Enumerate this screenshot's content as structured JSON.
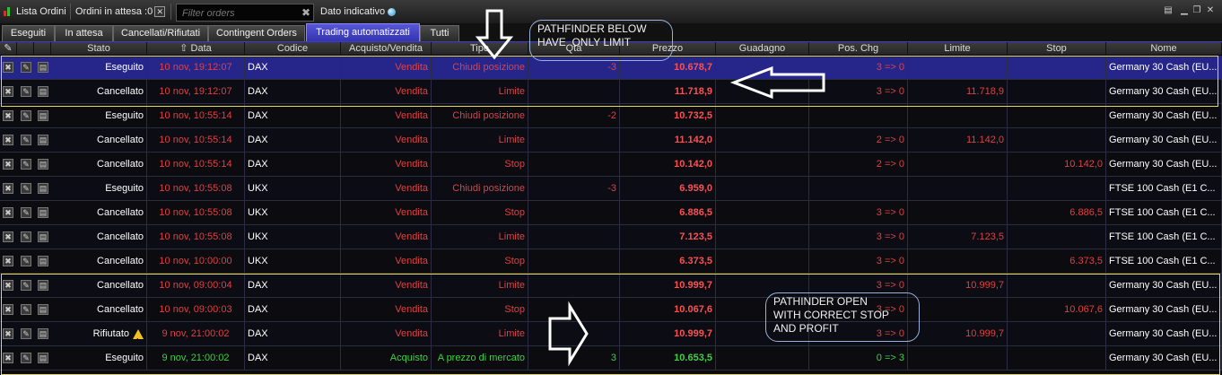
{
  "toolbar": {
    "title": "Lista Ordini",
    "pending_label": "Ordini in attesa :0",
    "filter_placeholder": "Filter orders",
    "indicative_label": "Dato indicativo"
  },
  "tabs": [
    {
      "label": "Eseguiti",
      "active": false
    },
    {
      "label": "In attesa",
      "active": false
    },
    {
      "label": "Cancellati/Rifiutati",
      "active": false
    },
    {
      "label": "Contingent Orders",
      "active": false
    },
    {
      "label": "Trading automatizzati",
      "active": true
    },
    {
      "label": "Tutti",
      "active": false
    }
  ],
  "columns": [
    "Stato",
    "Data",
    "Codice",
    "Acquisto/Vendita",
    "Tipo",
    "Qtà",
    "Prezzo",
    "Guadagno",
    "Pos. Chg",
    "Limite",
    "Stop",
    "Nome"
  ],
  "rows": [
    {
      "stato": "Eseguito",
      "data": "10 nov, 19:12:07",
      "codice": "DAX",
      "av": "Vendita",
      "tipo": "Chiudi posizione",
      "qta": "-3",
      "prezzo": "10.678,7",
      "guadagno": "",
      "poschg": "3 => 0",
      "limite": "",
      "stop": "",
      "nome": "Germany 30 Cash (EU...",
      "warn": false,
      "buy": false
    },
    {
      "stato": "Cancellato",
      "data": "10 nov, 19:12:07",
      "codice": "DAX",
      "av": "Vendita",
      "tipo": "Limite",
      "qta": "",
      "prezzo": "11.718,9",
      "guadagno": "",
      "poschg": "3 => 0",
      "limite": "11.718,9",
      "stop": "",
      "nome": "Germany 30 Cash (EU...",
      "warn": false,
      "buy": false
    },
    {
      "stato": "Eseguito",
      "data": "10 nov, 10:55:14",
      "codice": "DAX",
      "av": "Vendita",
      "tipo": "Chiudi posizione",
      "qta": "-2",
      "prezzo": "10.732,5",
      "guadagno": "",
      "poschg": "",
      "limite": "",
      "stop": "",
      "nome": "Germany 30 Cash (EU...",
      "warn": false,
      "buy": false
    },
    {
      "stato": "Cancellato",
      "data": "10 nov, 10:55:14",
      "codice": "DAX",
      "av": "Vendita",
      "tipo": "Limite",
      "qta": "",
      "prezzo": "11.142,0",
      "guadagno": "",
      "poschg": "2 => 0",
      "limite": "11.142,0",
      "stop": "",
      "nome": "Germany 30 Cash (EU...",
      "warn": false,
      "buy": false
    },
    {
      "stato": "Cancellato",
      "data": "10 nov, 10:55:14",
      "codice": "DAX",
      "av": "Vendita",
      "tipo": "Stop",
      "qta": "",
      "prezzo": "10.142,0",
      "guadagno": "",
      "poschg": "2 => 0",
      "limite": "",
      "stop": "10.142,0",
      "nome": "Germany 30 Cash (EU...",
      "warn": false,
      "buy": false
    },
    {
      "stato": "Eseguito",
      "data": "10 nov, 10:55:08",
      "codice": "UKX",
      "av": "Vendita",
      "tipo": "Chiudi posizione",
      "qta": "-3",
      "prezzo": "6.959,0",
      "guadagno": "",
      "poschg": "",
      "limite": "",
      "stop": "",
      "nome": "FTSE 100 Cash (E1 C...",
      "warn": false,
      "buy": false
    },
    {
      "stato": "Cancellato",
      "data": "10 nov, 10:55:08",
      "codice": "UKX",
      "av": "Vendita",
      "tipo": "Stop",
      "qta": "",
      "prezzo": "6.886,5",
      "guadagno": "",
      "poschg": "3 => 0",
      "limite": "",
      "stop": "6.886,5",
      "nome": "FTSE 100 Cash (E1 C...",
      "warn": false,
      "buy": false
    },
    {
      "stato": "Cancellato",
      "data": "10 nov, 10:55:08",
      "codice": "UKX",
      "av": "Vendita",
      "tipo": "Limite",
      "qta": "",
      "prezzo": "7.123,5",
      "guadagno": "",
      "poschg": "3 => 0",
      "limite": "7.123,5",
      "stop": "",
      "nome": "FTSE 100 Cash (E1 C...",
      "warn": false,
      "buy": false
    },
    {
      "stato": "Cancellato",
      "data": "10 nov, 10:00:00",
      "codice": "UKX",
      "av": "Vendita",
      "tipo": "Stop",
      "qta": "",
      "prezzo": "6.373,5",
      "guadagno": "",
      "poschg": "3 => 0",
      "limite": "",
      "stop": "6.373,5",
      "nome": "FTSE 100 Cash (E1 C...",
      "warn": false,
      "buy": false
    },
    {
      "stato": "Cancellato",
      "data": "10 nov, 09:00:04",
      "codice": "DAX",
      "av": "Vendita",
      "tipo": "Limite",
      "qta": "",
      "prezzo": "10.999,7",
      "guadagno": "",
      "poschg": "3 => 0",
      "limite": "10.999,7",
      "stop": "",
      "nome": "Germany 30 Cash (EU...",
      "warn": false,
      "buy": false
    },
    {
      "stato": "Cancellato",
      "data": "10 nov, 09:00:03",
      "codice": "DAX",
      "av": "Vendita",
      "tipo": "Stop",
      "qta": "",
      "prezzo": "10.067,6",
      "guadagno": "",
      "poschg": "3 => 0",
      "limite": "",
      "stop": "10.067,6",
      "nome": "Germany 30 Cash (EU...",
      "warn": false,
      "buy": false
    },
    {
      "stato": "Rifiutato",
      "data": "9 nov, 21:00:02",
      "codice": "DAX",
      "av": "Vendita",
      "tipo": "Limite",
      "qta": "",
      "prezzo": "10.999,7",
      "guadagno": "",
      "poschg": "3 => 0",
      "limite": "10.999,7",
      "stop": "",
      "nome": "Germany 30 Cash (EU...",
      "warn": true,
      "buy": false
    },
    {
      "stato": "Eseguito",
      "data": "9 nov, 21:00:02",
      "codice": "DAX",
      "av": "Acquisto",
      "tipo": "A prezzo di mercato",
      "qta": "3",
      "prezzo": "10.653,5",
      "guadagno": "",
      "poschg": "0 => 3",
      "limite": "",
      "stop": "",
      "nome": "Germany 30 Cash (EU...",
      "warn": false,
      "buy": true
    }
  ],
  "annotations": {
    "top_note": "PATHFINDER BELOW\nHAVE  ONLY LIMIT",
    "bottom_note": "PATHINDER OPEN\nWITH CORRECT STOP\nAND PROFIT"
  },
  "colors": {
    "sell": "#e04040",
    "buy": "#40d040",
    "selected_row": "#26268a",
    "highlight_box": "#e6d65a"
  }
}
